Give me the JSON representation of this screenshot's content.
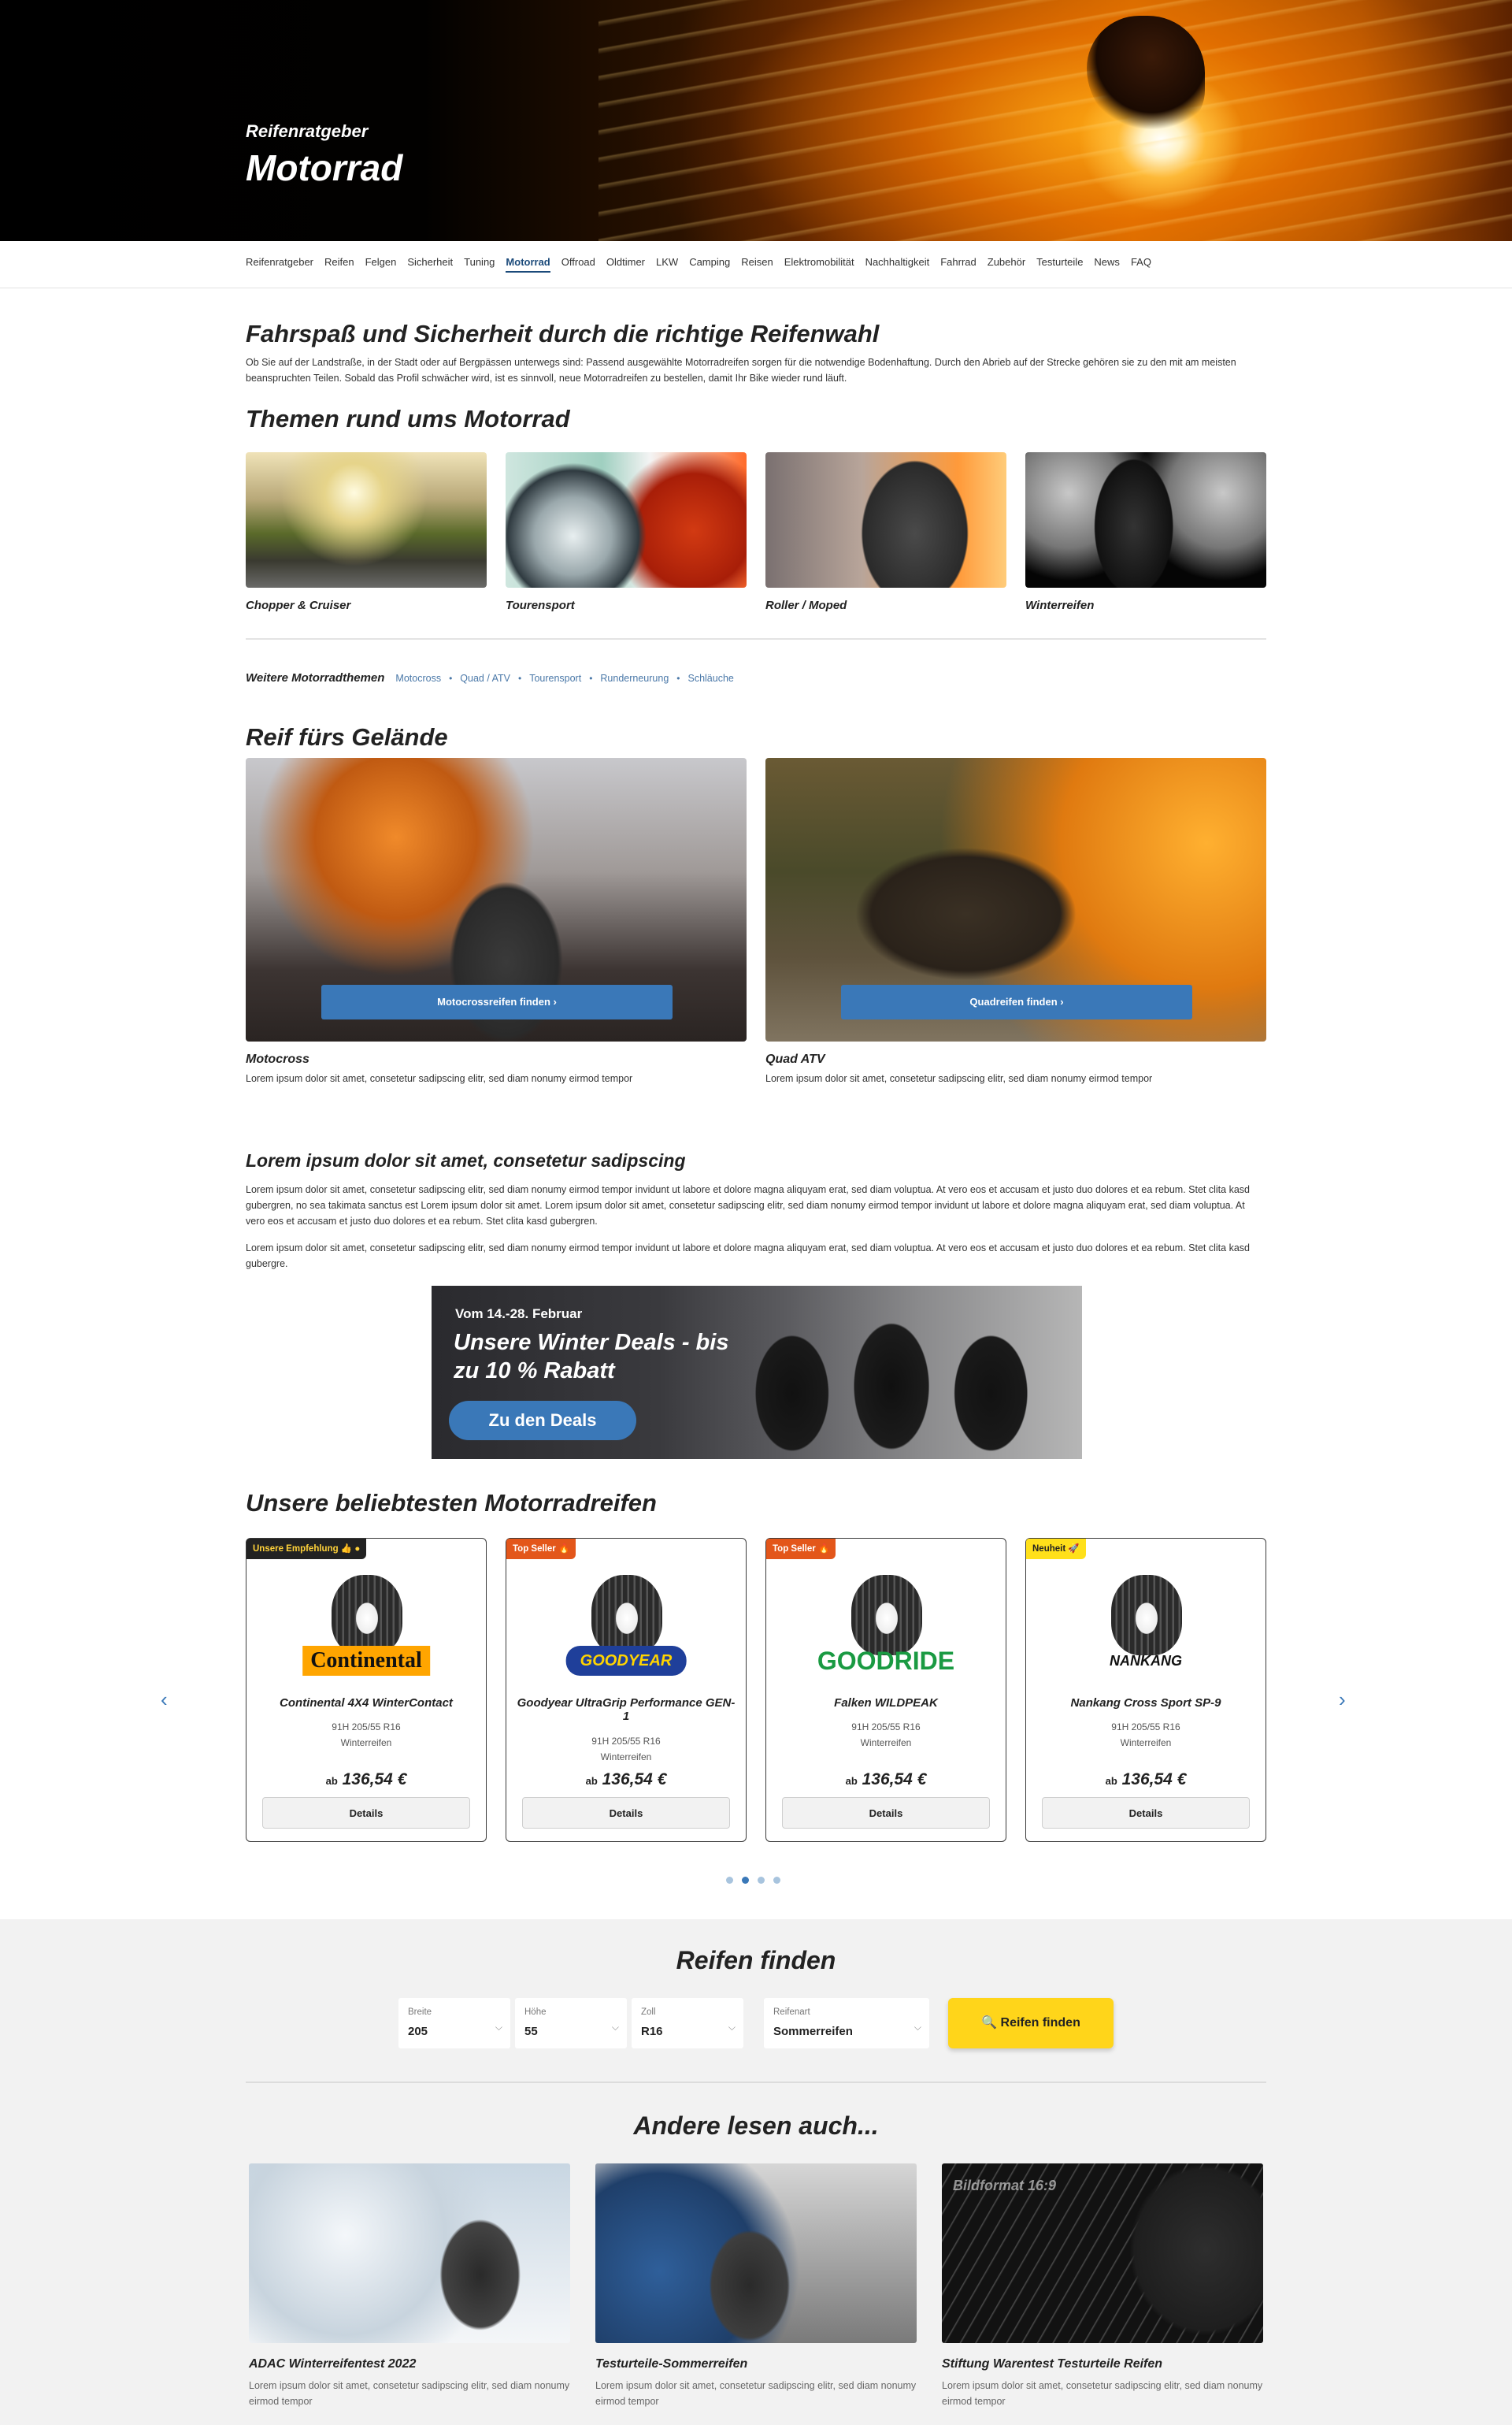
{
  "hero": {
    "kicker": "Reifenratgeber",
    "title": "Motorrad"
  },
  "nav": {
    "items": [
      "Reifenratgeber",
      "Reifen",
      "Felgen",
      "Sicherheit",
      "Tuning",
      "Motorrad",
      "Offroad",
      "Oldtimer",
      "LKW",
      "Camping",
      "Reisen",
      "Elektromobilität",
      "Nachhaltigkeit",
      "Fahrrad",
      "Zubehör",
      "Testurteile",
      "News",
      "FAQ"
    ],
    "active": "Motorrad"
  },
  "intro": {
    "title": "Fahrspaß und Sicherheit durch die richtige Reifenwahl",
    "text": "Ob Sie auf der Landstraße, in der Stadt oder auf Bergpässen unterwegs sind: Passend ausgewählte Motorradreifen sorgen für die notwendige Bodenhaftung. Durch den Abrieb auf der Strecke gehören sie zu den mit am meisten beanspruchten Teilen. Sobald das Profil schwächer wird, ist es sinnvoll, neue Motorradreifen zu bestellen, damit Ihr Bike wieder rund läuft."
  },
  "themes": {
    "title": "Themen rund ums Motorrad",
    "items": [
      {
        "label": "Chopper & Cruiser"
      },
      {
        "label": "Tourensport"
      },
      {
        "label": "Roller / Moped"
      },
      {
        "label": "Winterreifen"
      }
    ]
  },
  "more_topics": {
    "label": "Weitere Motorradthemen",
    "links": [
      "Motocross",
      "Quad / ATV",
      "Tourensport",
      "Runderneurung",
      "Schläuche"
    ]
  },
  "offroad": {
    "title": "Reif fürs Gelände",
    "items": [
      {
        "button": "Motocrossreifen finden  ›",
        "title": "Motocross",
        "desc": "Lorem ipsum dolor sit amet, consetetur sadipscing elitr, sed diam nonumy eirmod tempor"
      },
      {
        "button": "Quadreifen finden  ›",
        "title": "Quad ATV",
        "desc": "Lorem ipsum dolor sit amet, consetetur sadipscing elitr, sed diam nonumy eirmod tempor"
      }
    ]
  },
  "lorem": {
    "title": "Lorem ipsum dolor sit amet, consetetur sadipscing",
    "p1": "Lorem ipsum dolor sit amet, consetetur sadipscing elitr, sed diam nonumy eirmod tempor invidunt ut labore et dolore magna aliquyam erat, sed diam voluptua. At vero eos et accusam et justo duo dolores et ea rebum. Stet clita kasd gubergren, no sea takimata sanctus est Lorem ipsum dolor sit amet. Lorem ipsum dolor sit amet, consetetur sadipscing elitr, sed diam nonumy eirmod tempor invidunt ut labore et dolore magna aliquyam erat, sed diam voluptua. At vero eos et accusam et justo duo dolores et ea rebum. Stet clita kasd gubergren.",
    "p2": "Lorem ipsum dolor sit amet, consetetur sadipscing elitr, sed diam nonumy eirmod tempor invidunt ut labore et dolore magna aliquyam erat, sed diam voluptua. At vero eos et accusam et justo duo dolores et ea rebum. Stet clita kasd gubergre."
  },
  "banner": {
    "date": "Vom 14.-28. Februar",
    "title": "Unsere Winter Deals - bis zu 10 % Rabatt",
    "button": "Zu den Deals"
  },
  "products": {
    "title": "Unsere beliebtesten Motorradreifen",
    "items": [
      {
        "badge": "Unsere Empfehlung 👍 ●",
        "brand": "Continental",
        "name": "Continental 4X4 WinterContact",
        "spec": "91H 205/55 R16",
        "season": "Winterreifen",
        "price_prefix": "ab",
        "price": "136,54 €",
        "button": "Details"
      },
      {
        "badge": "Top Seller 🔥",
        "brand": "GOODYEAR",
        "name": "Goodyear UltraGrip Performance GEN-1",
        "spec": "91H 205/55 R16",
        "season": "Winterreifen",
        "price_prefix": "ab",
        "price": "136,54 €",
        "button": "Details"
      },
      {
        "badge": "Top Seller 🔥",
        "brand": "GOODRIDE",
        "name": "Falken WILDPEAK",
        "spec": "91H 205/55 R16",
        "season": "Winterreifen",
        "price_prefix": "ab",
        "price": "136,54 €",
        "button": "Details"
      },
      {
        "badge": "Neuheit 🚀",
        "brand": "NANKANG",
        "name": "Nankang Cross Sport SP-9",
        "spec": "91H 205/55 R16",
        "season": "Winterreifen",
        "price_prefix": "ab",
        "price": "136,54 €",
        "button": "Details"
      }
    ],
    "prev_icon": "‹",
    "next_icon": "›"
  },
  "finder": {
    "title": "Reifen finden",
    "fields": [
      {
        "label": "Breite",
        "value": "205"
      },
      {
        "label": "Höhe",
        "value": "55"
      },
      {
        "label": "Zoll",
        "value": "R16"
      },
      {
        "label": "Reifenart",
        "value": "Sommerreifen"
      }
    ],
    "button": "🔍  Reifen finden"
  },
  "related": {
    "title": "Andere lesen auch...",
    "items": [
      {
        "title": "ADAC Winterreifentest 2022",
        "desc": "Lorem ipsum dolor sit amet, consetetur sadipscing elitr, sed diam nonumy eirmod tempor",
        "overlay": ""
      },
      {
        "title": "Testurteile-Sommerreifen",
        "desc": "Lorem ipsum dolor sit amet, consetetur sadipscing elitr, sed diam nonumy eirmod tempor",
        "overlay": ""
      },
      {
        "title": "Stiftung Warentest Testurteile Reifen",
        "desc": "Lorem ipsum dolor sit amet, consetetur sadipscing elitr, sed diam nonumy eirmod tempor",
        "overlay": "Bildformat 16:9"
      }
    ]
  },
  "colors": {
    "primary": "#3a78b8",
    "accent": "#ffd51a",
    "nav_active": "#1b4a7a",
    "top_seller": "#e3561a"
  }
}
